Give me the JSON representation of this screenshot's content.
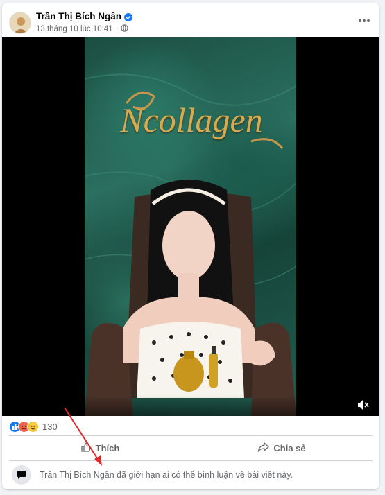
{
  "post": {
    "author": "Trần Thị Bích Ngân",
    "timestamp": "13 tháng 10 lúc 10:41",
    "audience_icon": "globe-icon",
    "verified_icon": "verified-badge-icon",
    "more_icon": "more-options-icon"
  },
  "video": {
    "brand_text": "Ncollagen",
    "mute_icon": "volume-muted-icon"
  },
  "reactions": {
    "types": [
      "like",
      "angry",
      "haha"
    ],
    "count": "130"
  },
  "actions": {
    "like_label": "Thích",
    "share_label": "Chia sẻ"
  },
  "comments": {
    "restricted_notice": "Trần Thị Bích Ngân đã giới hạn ai có thể bình luận về bài viết này."
  },
  "colors": {
    "accent": "#1877f2",
    "secondary_text": "#65676b",
    "annotation_arrow": "#e8262a"
  }
}
